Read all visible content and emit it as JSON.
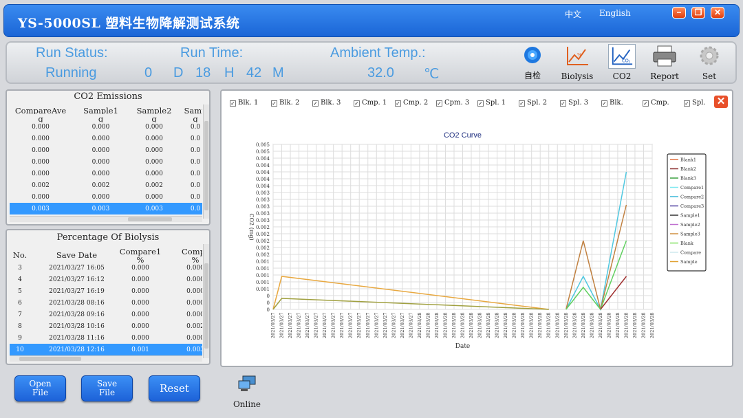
{
  "window": {
    "title": "YS-5000SL 塑料生物降解测试系统",
    "lang_cn": "中文",
    "lang_en": "English",
    "minimize": "−",
    "restore": "❐",
    "close": "✕"
  },
  "status": {
    "run_status_label": "Run Status:",
    "run_status_value": "Running",
    "run_time_label": "Run Time:",
    "days": "0",
    "days_unit": "D",
    "hours": "18",
    "hours_unit": "H",
    "minutes": "42",
    "minutes_unit": "M",
    "ambient_label": "Ambient Temp.:",
    "ambient_value": "32.0",
    "ambient_unit": "℃"
  },
  "toolbar": {
    "selfcheck": "自检",
    "biolysis": "Biolysis",
    "co2": "CO2",
    "report": "Report",
    "set": "Set"
  },
  "co2_panel": {
    "title": "CO2 Emissions",
    "columns": [
      "CompareAve",
      "Sample1",
      "Sample2",
      "Samp"
    ],
    "units": [
      "g",
      "g",
      "g",
      "g"
    ],
    "rows": [
      [
        "0.000",
        "0.000",
        "0.000",
        "0.0"
      ],
      [
        "0.000",
        "0.000",
        "0.000",
        "0.0"
      ],
      [
        "0.000",
        "0.000",
        "0.000",
        "0.0"
      ],
      [
        "0.000",
        "0.000",
        "0.000",
        "0.0"
      ],
      [
        "0.000",
        "0.000",
        "0.000",
        "0.0"
      ],
      [
        "0.002",
        "0.002",
        "0.002",
        "0.0"
      ],
      [
        "0.000",
        "0.000",
        "0.000",
        "0.0"
      ],
      [
        "0.003",
        "0.003",
        "0.003",
        "0.0"
      ]
    ],
    "selected_row": 7
  },
  "biolysis_panel": {
    "title": "Percentage Of Biolysis",
    "columns": [
      "No.",
      "Save Date",
      "Compare1",
      "Compar"
    ],
    "units": [
      "",
      "",
      "%",
      "%"
    ],
    "rows": [
      [
        "3",
        "2021/03/27 16:05",
        "0.000",
        "0.000"
      ],
      [
        "4",
        "2021/03/27 16:12",
        "0.000",
        "0.000"
      ],
      [
        "5",
        "2021/03/27 16:19",
        "0.000",
        "0.000"
      ],
      [
        "6",
        "2021/03/28 08:16",
        "0.000",
        "0.000"
      ],
      [
        "7",
        "2021/03/28 09:16",
        "0.000",
        "0.000"
      ],
      [
        "8",
        "2021/03/28 10:16",
        "0.000",
        "0.002"
      ],
      [
        "9",
        "2021/03/28 11:16",
        "0.000",
        "0.000"
      ],
      [
        "10",
        "2021/03/28 12:16",
        "0.001",
        "0.003"
      ]
    ],
    "selected_row": 7
  },
  "checkboxes": [
    {
      "label": "Blk. 1",
      "checked": true
    },
    {
      "label": "Blk. 2",
      "checked": true
    },
    {
      "label": "Blk. 3",
      "checked": true
    },
    {
      "label": "Cmp. 1",
      "checked": true
    },
    {
      "label": "Cmp. 2",
      "checked": true
    },
    {
      "label": "Cpm. 3",
      "checked": true
    },
    {
      "label": "Spl. 1",
      "checked": true
    },
    {
      "label": "Spl. 2",
      "checked": true
    },
    {
      "label": "Spl. 3",
      "checked": true
    },
    {
      "label": "Blk.",
      "checked": true
    },
    {
      "label": "Cmp.",
      "checked": true
    },
    {
      "label": "Spl.",
      "checked": true
    }
  ],
  "chart_close": "✕",
  "chart_data": {
    "type": "line",
    "title": "CO2 Curve",
    "xlabel": "Date",
    "ylabel": "CO2 (mg)",
    "ylim": [
      0,
      0.006
    ],
    "y_tick_labels": [
      "0",
      "0",
      "0",
      "0.001",
      "0.001",
      "0.001",
      "0.001",
      "0.001",
      "0.002",
      "0.002",
      "0.002",
      "0.002",
      "0.002",
      "0.003",
      "0.003",
      "0.003",
      "0.003",
      "0.003",
      "0.004",
      "0.004",
      "0.004",
      "0.004",
      "0.004",
      "0.005",
      "0.005"
    ],
    "x_tick_labels": [
      "2021/03/27",
      "2021/03/27",
      "2021/03/27",
      "2021/03/27",
      "2021/03/27",
      "2021/03/27",
      "2021/03/27",
      "2021/03/27",
      "2021/03/27",
      "2021/03/27",
      "2021/03/27",
      "2021/03/27",
      "2021/03/27",
      "2021/03/27",
      "2021/03/27",
      "2021/03/27",
      "2021/03/27",
      "2021/03/28",
      "2021/03/28",
      "2021/03/28",
      "2021/03/28",
      "2021/03/28",
      "2021/03/28",
      "2021/03/28",
      "2021/03/28",
      "2021/03/28",
      "2021/03/28",
      "2021/03/28",
      "2021/03/28",
      "2021/03/28",
      "2021/03/28",
      "2021/03/28",
      "2021/03/28",
      "2021/03/28",
      "2021/03/28",
      "2021/03/28",
      "2021/03/28",
      "2021/03/28",
      "2021/03/28",
      "2021/03/28",
      "2021/03/28",
      "2021/03/28",
      "2021/03/28",
      "2021/03/28",
      "2021/03/28"
    ],
    "series": [
      {
        "name": "Blank1",
        "color": "#e07040",
        "points": [
          [
            0,
            0
          ],
          [
            1,
            0
          ],
          [
            33,
            0
          ],
          [
            35,
            0
          ],
          [
            37,
            0
          ],
          [
            39,
            0
          ],
          [
            41,
            0
          ]
        ]
      },
      {
        "name": "Blank2",
        "color": "#8b2e2e",
        "points": [
          [
            0,
            0
          ],
          [
            1,
            0
          ],
          [
            33,
            0
          ],
          [
            35,
            0
          ],
          [
            37,
            0
          ],
          [
            39,
            0
          ],
          [
            41,
            0.0012
          ]
        ]
      },
      {
        "name": "Blank3",
        "color": "#3aa040",
        "points": [
          [
            0,
            0
          ],
          [
            1,
            0
          ],
          [
            33,
            0
          ],
          [
            35,
            0
          ],
          [
            37,
            0
          ],
          [
            39,
            0
          ],
          [
            41,
            0
          ]
        ]
      },
      {
        "name": "Compare1",
        "color": "#7de8f0",
        "points": [
          [
            0,
            0
          ],
          [
            1,
            0
          ],
          [
            33,
            0
          ],
          [
            35,
            0
          ],
          [
            37,
            0
          ],
          [
            39,
            0
          ],
          [
            41,
            0
          ]
        ]
      },
      {
        "name": "Compare2",
        "color": "#3ab8d8",
        "points": [
          [
            0,
            0
          ],
          [
            1,
            0
          ],
          [
            33,
            0
          ],
          [
            35,
            0
          ],
          [
            37,
            0
          ],
          [
            39,
            0
          ],
          [
            41,
            0.005
          ]
        ]
      },
      {
        "name": "Compare3",
        "color": "#5040a0",
        "points": [
          [
            0,
            0
          ],
          [
            1,
            0
          ],
          [
            33,
            0
          ],
          [
            35,
            0
          ],
          [
            37,
            0
          ],
          [
            39,
            0
          ],
          [
            41,
            0
          ]
        ]
      },
      {
        "name": "Sample1",
        "color": "#333333",
        "points": [
          [
            0,
            0
          ],
          [
            1,
            0
          ],
          [
            33,
            0
          ],
          [
            35,
            0
          ],
          [
            37,
            0
          ],
          [
            39,
            0
          ],
          [
            41,
            0
          ]
        ]
      },
      {
        "name": "Sample2",
        "color": "#c070d0",
        "points": [
          [
            0,
            0
          ],
          [
            1,
            0
          ],
          [
            33,
            0
          ],
          [
            35,
            0
          ],
          [
            37,
            0
          ],
          [
            39,
            0
          ],
          [
            41,
            0
          ]
        ]
      },
      {
        "name": "Sample3",
        "color": "#d09040",
        "points": [
          [
            0,
            0
          ],
          [
            1,
            0
          ],
          [
            33,
            0
          ],
          [
            35,
            0
          ],
          [
            37,
            0
          ],
          [
            39,
            0
          ],
          [
            41,
            0
          ]
        ]
      },
      {
        "name": "Blank",
        "color": "#80e060",
        "points": [
          [
            0,
            0
          ],
          [
            1,
            0
          ],
          [
            33,
            0
          ],
          [
            35,
            0
          ],
          [
            37,
            0
          ],
          [
            39,
            0
          ],
          [
            41,
            0.0025
          ]
        ]
      },
      {
        "name": "Compare",
        "color": "#cde8ee",
        "points": [
          [
            0,
            0
          ],
          [
            1,
            0
          ],
          [
            33,
            0
          ],
          [
            35,
            0
          ],
          [
            37,
            0
          ],
          [
            39,
            0
          ],
          [
            41,
            0
          ]
        ]
      },
      {
        "name": "Sample",
        "color": "#e0a030",
        "points": [
          [
            0,
            0
          ],
          [
            1,
            0
          ],
          [
            33,
            0
          ],
          [
            35,
            0
          ],
          [
            37,
            0
          ],
          [
            39,
            0
          ],
          [
            41,
            0
          ]
        ]
      }
    ],
    "visible_paths": [
      {
        "name": "Sample",
        "color": "#e8a840",
        "points": [
          [
            0,
            0
          ],
          [
            1,
            0.0012
          ],
          [
            32,
            0
          ]
        ]
      },
      {
        "name": "Blank",
        "color": "#a0a040",
        "points": [
          [
            0,
            0
          ],
          [
            1,
            0.0004
          ],
          [
            32,
            0
          ]
        ]
      },
      {
        "name": "Compare2",
        "color": "#50c8e0",
        "points": [
          [
            34,
            0
          ],
          [
            36,
            0.0012
          ],
          [
            38,
            0
          ],
          [
            41,
            0.005
          ]
        ]
      },
      {
        "name": "Sample3",
        "color": "#c08040",
        "points": [
          [
            34,
            0
          ],
          [
            36,
            0.0025
          ],
          [
            38,
            0
          ],
          [
            41,
            0.0038
          ]
        ]
      },
      {
        "name": "Blank",
        "color": "#60d060",
        "points": [
          [
            34,
            0
          ],
          [
            36,
            0.0008
          ],
          [
            38,
            0
          ],
          [
            41,
            0.0025
          ]
        ]
      },
      {
        "name": "Blank2",
        "color": "#a03030",
        "points": [
          [
            38,
            0
          ],
          [
            41,
            0.0012
          ]
        ]
      }
    ],
    "legend_position": "right",
    "grid": true
  },
  "buttons": {
    "open_line1": "Open",
    "open_line2": "File",
    "save_line1": "Save",
    "save_line2": "File",
    "reset": "Reset",
    "online": "Online"
  }
}
